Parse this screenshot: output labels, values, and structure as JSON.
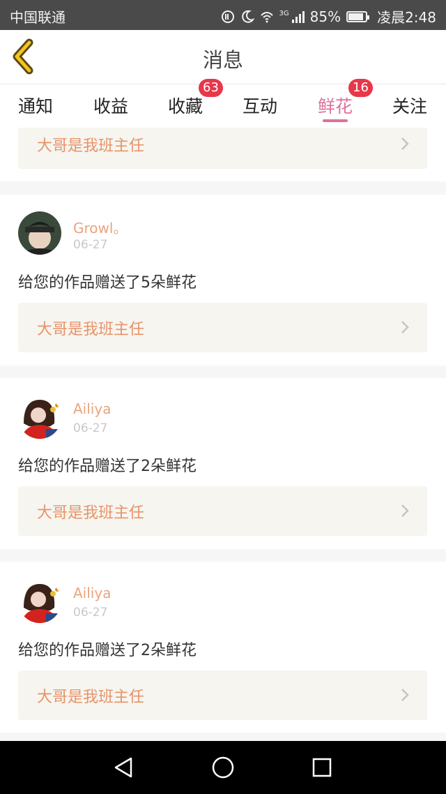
{
  "status_bar": {
    "carrier": "中国联通",
    "network": "3G",
    "battery": "85%",
    "time": "凌晨2:48"
  },
  "header": {
    "title": "消息"
  },
  "tabs": [
    {
      "label": "通知",
      "badge": ""
    },
    {
      "label": "收益",
      "badge": ""
    },
    {
      "label": "收藏",
      "badge": "63"
    },
    {
      "label": "互动",
      "badge": ""
    },
    {
      "label": "鲜花",
      "badge": "16",
      "active": true
    },
    {
      "label": "关注",
      "badge": ""
    }
  ],
  "partial_top_card": {
    "work_title": "大哥是我班主任"
  },
  "messages": [
    {
      "username": "Growl。",
      "date": "06-27",
      "text": "给您的作品赠送了5朵鲜花",
      "work_title": "大哥是我班主任"
    },
    {
      "username": "Ailiya",
      "date": "06-27",
      "text": "给您的作品赠送了2朵鲜花",
      "work_title": "大哥是我班主任"
    },
    {
      "username": "Ailiya",
      "date": "06-27",
      "text": "给您的作品赠送了2朵鲜花",
      "work_title": "大哥是我班主任"
    }
  ],
  "colors": {
    "accent_pink": "#e0709c",
    "badge_red": "#e8374a",
    "username_orange": "#e8a57e",
    "work_title_orange": "#e8936a",
    "back_arrow_yellow": "#f5c518"
  },
  "icons": {
    "back": "back-arrow-icon",
    "chevron": "chevron-right-icon",
    "nav_back": "triangle-back-icon",
    "nav_home": "circle-home-icon",
    "nav_recent": "square-recents-icon"
  }
}
